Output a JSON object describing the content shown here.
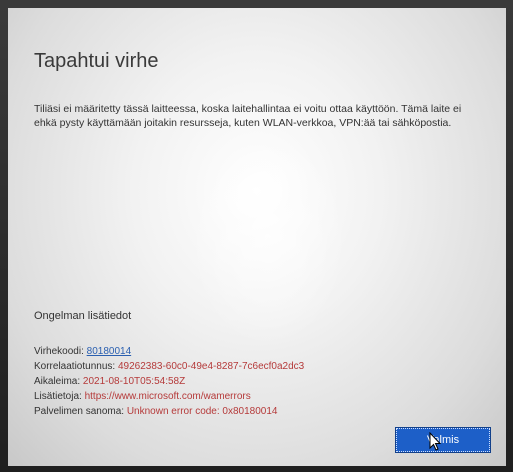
{
  "dialog": {
    "title": "Tapahtui virhe",
    "message": "Tiliäsi ei määritetty tässä laitteessa, koska laitehallintaa ei voitu ottaa käyttöön. Tämä laite ei ehkä pysty käyttämään joitakin resursseja, kuten WLAN-verkkoa, VPN:ää tai sähköpostia.",
    "details_heading": "Ongelman lisätiedot",
    "details": {
      "error_code_label": "Virhekoodi: ",
      "error_code_value": "80180014",
      "correlation_label": "Korrelaatiotunnus: ",
      "correlation_value": "49262383-60c0-49e4-8287-7c6ecf0a2dc3",
      "timestamp_label": "Aikaleima: ",
      "timestamp_value": "2021-08-10T05:54:58Z",
      "more_info_label": "Lisätietoja: ",
      "more_info_value": "https://www.microsoft.com/wamerrors",
      "server_message_label": "Palvelimen sanoma: ",
      "server_message_value": "Unknown error code: 0x80180014"
    },
    "done_button": "Valmis"
  },
  "colors": {
    "accent": "#1d5fc8",
    "error_text": "#b53a3a",
    "link": "#2a5fb0"
  }
}
